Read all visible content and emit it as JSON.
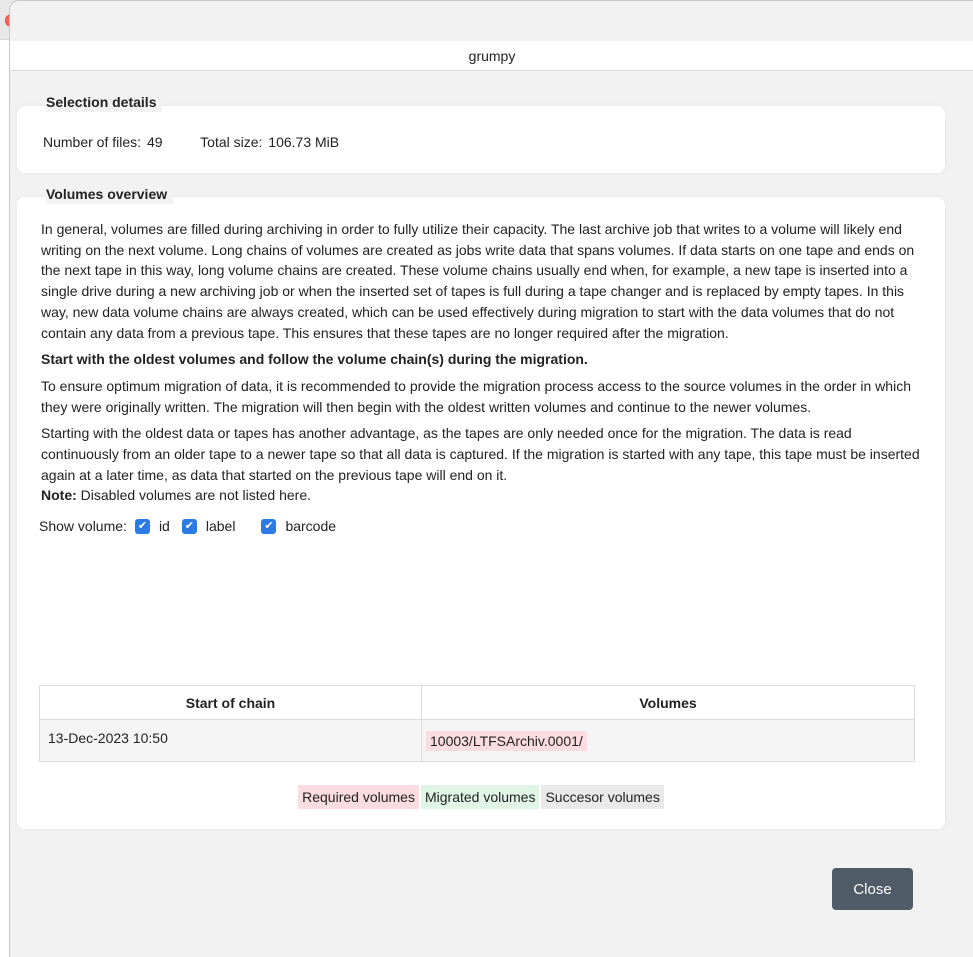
{
  "window": {
    "title": "grumpy"
  },
  "selection": {
    "legend": "Selection details",
    "files_label": "Number of files:",
    "files_value": "49",
    "size_label": "Total size:",
    "size_value": "106.73 MiB"
  },
  "volumes": {
    "legend": "Volumes overview",
    "para1": "In general, volumes are filled during archiving in order to fully utilize their capacity. The last archive job that writes to a volume will likely end writing on the next volume. Long chains of volumes are created as jobs write data that spans volumes. If data starts on one tape and ends on the next tape in this way, long volume chains are created. These volume chains usually end when, for example, a new tape is inserted into a single drive during a new archiving job or when the inserted set of tapes is full during a tape changer and is replaced by empty tapes. In this way, new data volume chains are always created, which can be used effectively during migration to start with the data volumes that do not contain any data from a previous tape. This ensures that these tapes are no longer required after the migration.",
    "heading": "Start with the oldest volumes and follow the volume chain(s) during the migration.",
    "para2": "To ensure optimum migration of data, it is recommended to provide the migration process access to the source volumes in the order in which they were originally written. The migration will then begin with the oldest written volumes and continue to the newer volumes.",
    "para3": "Starting with the oldest data or tapes has another advantage, as the tapes are only needed once for the migration. The data is read continuously from an older tape to a newer tape so that all data is captured. If the migration is started with any tape, this tape must be inserted again at a later time, as data that started on the previous tape will end on it.",
    "note_label": "Note:",
    "note_text": " Disabled volumes are not listed here.",
    "show_label": "Show volume:",
    "checkboxes": [
      {
        "label": "id",
        "checked": true
      },
      {
        "label": "label",
        "checked": true
      },
      {
        "label": "barcode",
        "checked": true
      }
    ],
    "table": {
      "headers": [
        "Start of chain",
        "Volumes"
      ],
      "rows": [
        {
          "start": "13-Dec-2023 10:50",
          "volume": "10003/LTFSArchiv.0001/"
        }
      ]
    },
    "legend_chips": {
      "required": "Required volumes",
      "migrated": "Migrated volumes",
      "successor": "Succesor volumes"
    }
  },
  "buttons": {
    "close": "Close"
  },
  "colors": {
    "required": "#fbdde1",
    "migrated": "#e0f5e6",
    "successor": "#e9e9e9",
    "checkbox": "#2c7be5",
    "close_button": "#4f5b66"
  }
}
